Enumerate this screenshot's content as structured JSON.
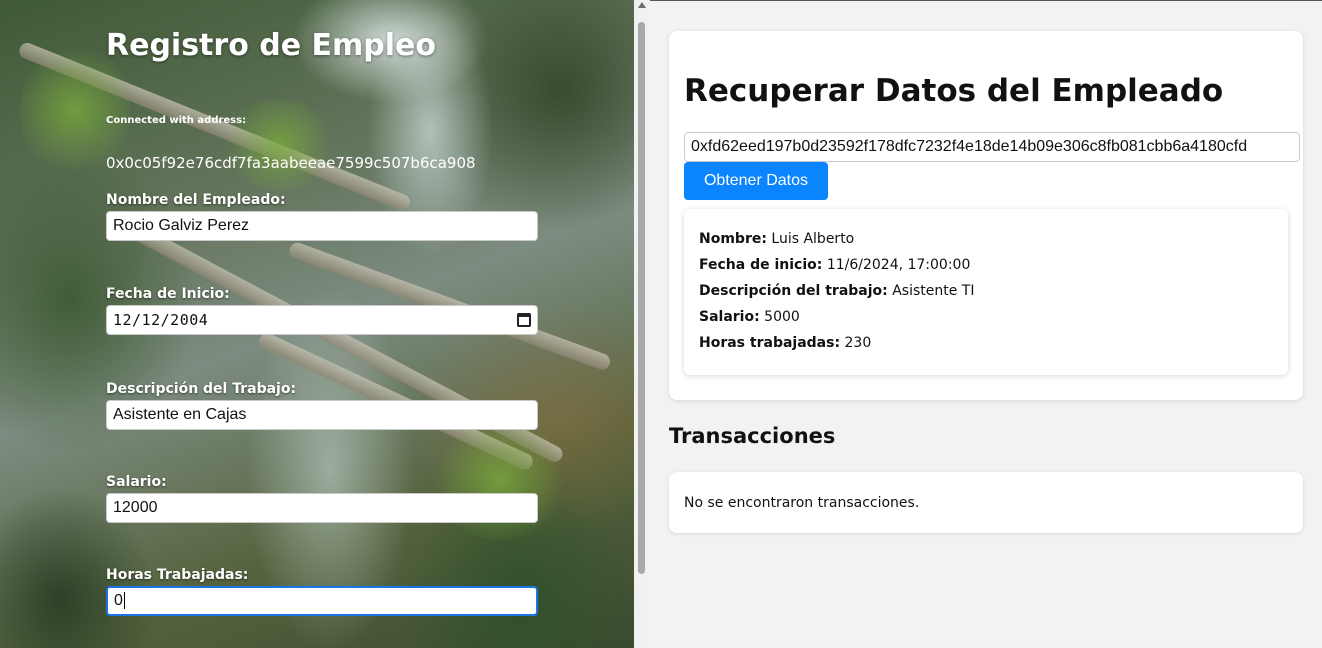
{
  "registration": {
    "title": "Registro de Empleo",
    "connected_label": "Connected with address:",
    "connected_address": "0x0c05f92e76cdf7fa3aabeeae7599c507b6ca908",
    "fields": {
      "name": {
        "label": "Nombre del Empleado:",
        "value": "Rocio Galviz Perez"
      },
      "start_date": {
        "label": "Fecha de Inicio:",
        "value": "12/12/2004",
        "icon": "calendar-icon"
      },
      "description": {
        "label": "Descripción del Trabajo:",
        "value": "Asistente en Cajas"
      },
      "salary": {
        "label": "Salario:",
        "value": "12000"
      },
      "hours": {
        "label": "Horas Trabajadas:",
        "value": "0"
      }
    }
  },
  "retrieve": {
    "title": "Recuperar Datos del Empleado",
    "hash_value": "0xfd62eed197b0d23592f178dfc7232f4e18de14b09e306c8fb081cbb6a4180cfd",
    "button_label": "Obtener Datos",
    "button_color": "#0a84ff",
    "details": {
      "name": {
        "label": "Nombre:",
        "value": "Luis Alberto"
      },
      "start_date": {
        "label": "Fecha de inicio:",
        "value": "11/6/2024, 17:00:00"
      },
      "description": {
        "label": "Descripción del trabajo:",
        "value": "Asistente TI"
      },
      "salary": {
        "label": "Salario:",
        "value": "5000"
      },
      "hours": {
        "label": "Horas trabajadas:",
        "value": "230"
      }
    }
  },
  "transactions": {
    "title": "Transacciones",
    "empty_message": "No se encontraron transacciones."
  },
  "focus_color": "#1a73e8"
}
